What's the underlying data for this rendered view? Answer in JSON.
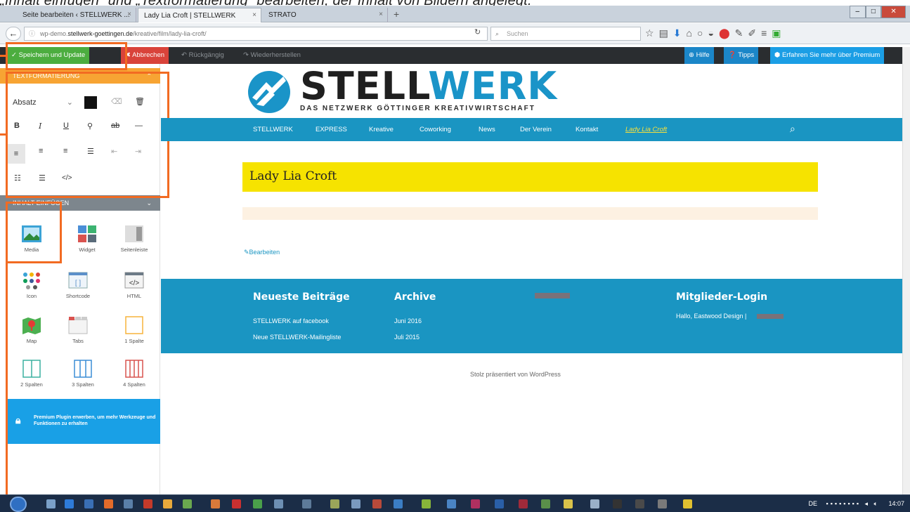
{
  "caption": "„Inhalt einfügen“ und „Textformatierung“ bearbeiten; der Inhalt von Bildern angelegt.",
  "browser": {
    "tabs": [
      {
        "label": "Seite bearbeiten ‹ STELLWERK ..."
      },
      {
        "label": "Lady Lia Croft | STELLWERK"
      },
      {
        "label": "STRATO"
      }
    ],
    "url_prefix": "wp-demo.",
    "url_domain": "stellwerk-goettingen.de",
    "url_path": "/kreative/film/lady-lia-croft/",
    "search_placeholder": "Suchen"
  },
  "toolbar": {
    "save_label": "Speichern und Update",
    "cancel_label": "Abbrechen",
    "undo_label": "Rückgängig",
    "redo_label": "Wiederherstellen",
    "help_label": "Hilfe",
    "tips_label": "Tipps",
    "premium_label": "Erfahren Sie mehr über Premium"
  },
  "panel": {
    "text_section": "TEXTFORMATIERUNG",
    "paragraph_select": "Absatz",
    "content_section": "INHALT EINFÜGEN",
    "tiles": [
      "Media",
      "Widget",
      "Seitenleiste",
      "Icon",
      "Shortcode",
      "HTML",
      "Map",
      "Tabs",
      "1 Spalte",
      "2 Spalten",
      "3 Spalten",
      "4 Spalten"
    ],
    "premium_text": "Premium Plugin erwerben, um mehr Werkzeuge und Funktionen zu erhalten"
  },
  "site": {
    "logo": "STELLWERK",
    "logo_part1": "STELL",
    "logo_part2": "WERK",
    "tagline": "DAS NETZWERK GÖTTINGER KREATIVWIRTSCHAFT",
    "nav": [
      "STELLWERK",
      "EXPRESS",
      "Kreative",
      "Coworking",
      "News",
      "Der Verein",
      "Kontakt",
      "Lady Lia Croft"
    ],
    "page_title": "Lady Lia Croft",
    "edit_link": "Bearbeiten",
    "footer": {
      "col1_title": "Neueste Beiträge",
      "col1_items": [
        "STELLWERK auf facebook",
        "Neue STELLWERK-Mailingliste"
      ],
      "col2_title": "Archive",
      "col2_items": [
        "Juni 2016",
        "Juli 2015"
      ],
      "col3_title": "Mitglieder-Login",
      "greeting": "Hallo, Eastwood Design |"
    },
    "powered_by": "Stolz präsentiert von WordPress"
  },
  "taskbar": {
    "lang": "DE",
    "clock": "14:07"
  },
  "colors": {
    "accent": "#1a95c2",
    "highlight": "#f26b22",
    "title_bg": "#f6e300",
    "save": "#4cad3f",
    "cancel": "#d9433a"
  }
}
